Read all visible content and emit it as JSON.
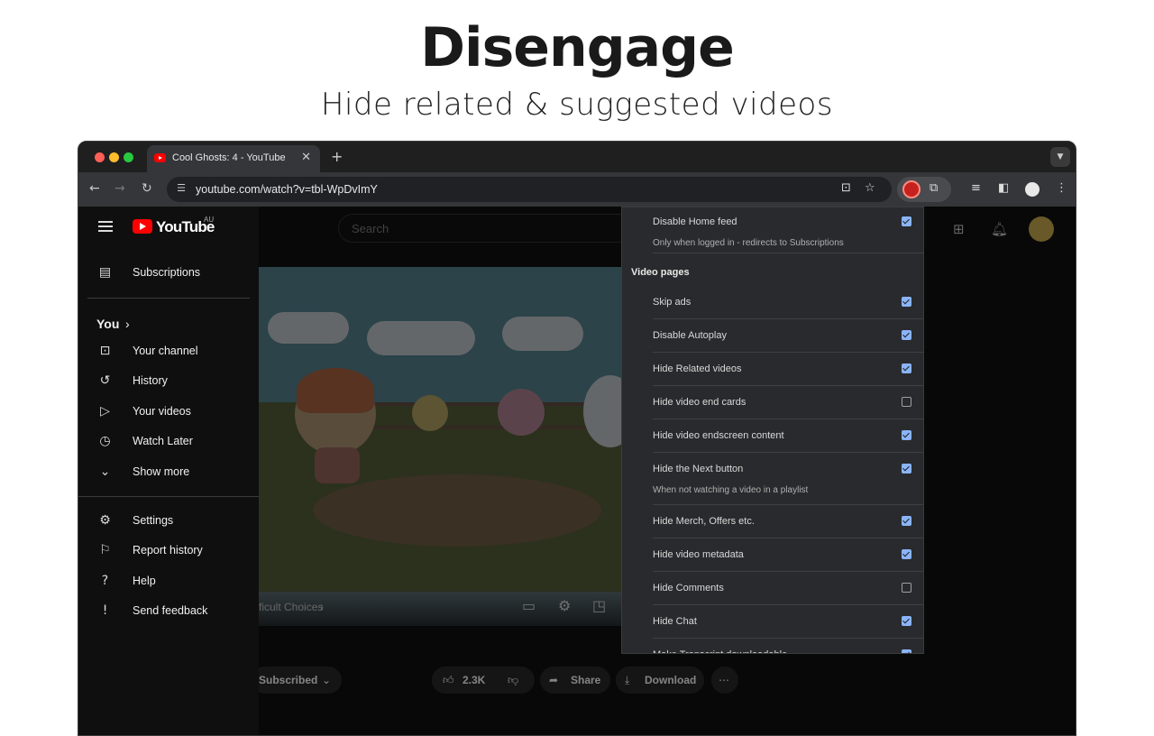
{
  "hero": {
    "title": "Disengage",
    "subtitle": "Hide related & suggested videos"
  },
  "browser": {
    "tab_title": "Cool Ghosts: 4 - YouTube",
    "url": "youtube.com/watch?v=tbl-WpDvImY"
  },
  "youtube": {
    "logo_text": "YouTube",
    "region": "AU",
    "search_placeholder": "Search",
    "sidebar": {
      "subscriptions": "Subscriptions",
      "you_heading": "You",
      "you_chevron": "›",
      "you_items": [
        "Your channel",
        "History",
        "Your videos",
        "Watch Later",
        "Show more"
      ],
      "settings_items": [
        "Settings",
        "Report history",
        "Help",
        "Send feedback"
      ]
    },
    "player": {
      "chapter": "ficult Choices"
    },
    "actions": {
      "subscribed": "Subscribed",
      "likes": "2.3K",
      "share": "Share",
      "download": "Download"
    }
  },
  "popup": {
    "home_row": {
      "label": "Disable Home feed",
      "hint": "Only when logged in - redirects to Subscriptions",
      "checked": true
    },
    "section_title": "Video pages",
    "rows": [
      {
        "label": "Skip ads",
        "checked": true
      },
      {
        "label": "Disable Autoplay",
        "checked": true
      },
      {
        "label": "Hide Related videos",
        "checked": true
      },
      {
        "label": "Hide video end cards",
        "checked": false
      },
      {
        "label": "Hide video endscreen content",
        "checked": true
      },
      {
        "label": "Hide the Next button",
        "hint": "When not watching a video in a playlist",
        "checked": true
      },
      {
        "label": "Hide Merch, Offers etc.",
        "checked": true
      },
      {
        "label": "Hide video metadata",
        "checked": true
      },
      {
        "label": "Hide Comments",
        "checked": false
      },
      {
        "label": "Hide Chat",
        "checked": true
      },
      {
        "label": "Make Transcript downloadable",
        "checked": true
      }
    ]
  },
  "colors": {
    "accent_checkbox": "#8ab4f8",
    "youtube_red": "#ff0000"
  }
}
